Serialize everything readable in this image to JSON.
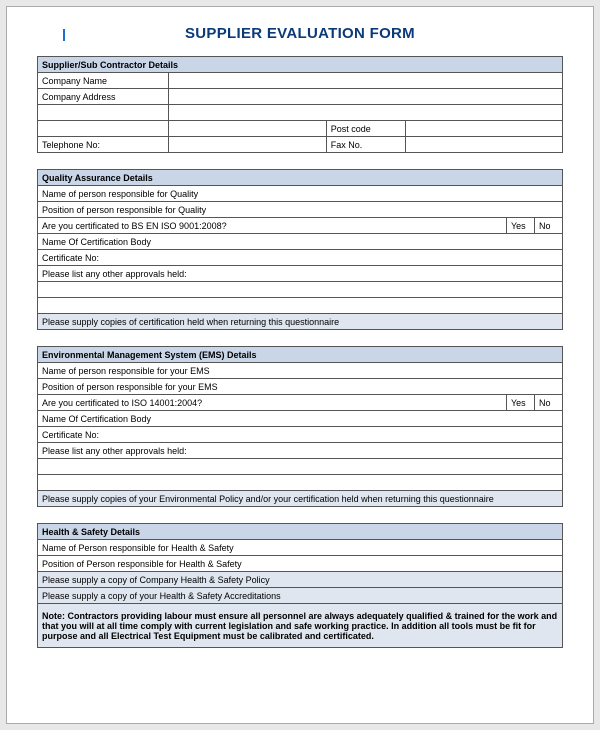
{
  "title": "SUPPLIER EVALUATION FORM",
  "supplier": {
    "header": "Supplier/Sub Contractor Details",
    "company_name_label": "Company Name",
    "company_address_label": "Company Address",
    "post_code_label": "Post code",
    "telephone_label": "Telephone No:",
    "fax_label": "Fax No."
  },
  "qa": {
    "header": "Quality Assurance Details",
    "name_label": "Name of person responsible for Quality",
    "position_label": "Position of person responsible for Quality",
    "cert_question": "Are you certificated to BS EN ISO 9001:2008?",
    "yes": "Yes",
    "no": "No",
    "cert_body_label": "Name Of Certification Body",
    "cert_no_label": "Certificate No:",
    "approvals_label": "Please list any other approvals held:",
    "copies_note": "Please supply copies of certification held when returning this questionnaire"
  },
  "ems": {
    "header": "Environmental Management System (EMS) Details",
    "name_label": "Name of person responsible for your EMS",
    "position_label": "Position of person responsible for your EMS",
    "cert_question": "Are you certificated to ISO 14001:2004?",
    "yes": "Yes",
    "no": "No",
    "cert_body_label": "Name Of Certification Body",
    "cert_no_label": "Certificate No:",
    "approvals_label": "Please list any other approvals held:",
    "copies_note": "Please supply copies of your Environmental Policy and/or your certification held when returning this questionnaire"
  },
  "hs": {
    "header": "Health & Safety Details",
    "name_label": "Name of Person responsible for Health & Safety",
    "position_label": "Position of Person responsible for Health & Safety",
    "policy_note": "Please supply a copy of Company Health & Safety Policy",
    "accred_note": "Please supply a copy of your Health & Safety Accreditations",
    "contractor_note": "Note: Contractors providing labour must ensure all personnel are always adequately qualified & trained for the work and that you will at all time comply with current legislation and safe working practice. In addition all tools must be fit for purpose and all Electrical Test Equipment must be calibrated and certificated."
  }
}
